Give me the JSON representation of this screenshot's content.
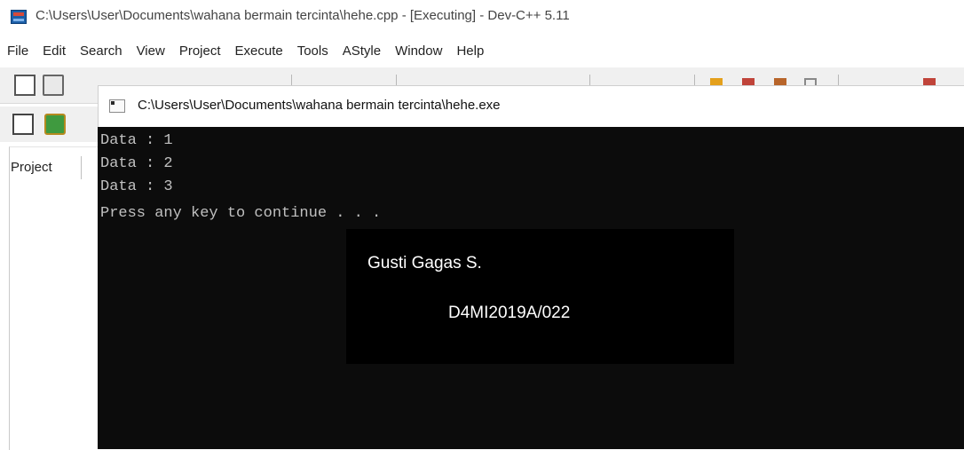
{
  "ide": {
    "title": "C:\\Users\\User\\Documents\\wahana bermain tercinta\\hehe.cpp - [Executing] - Dev-C++ 5.11",
    "menu": [
      "File",
      "Edit",
      "Search",
      "View",
      "Project",
      "Execute",
      "Tools",
      "AStyle",
      "Window",
      "Help"
    ],
    "left_panel_tab": "Project"
  },
  "console": {
    "title": "C:\\Users\\User\\Documents\\wahana bermain tercinta\\hehe.exe",
    "lines": [
      "Data : 1",
      "Data : 2",
      "Data : 3",
      "Press any key to continue . . ."
    ]
  },
  "overlay": {
    "name": "Gusti Gagas S.",
    "id": "D4MI2019A/022"
  },
  "colors": {
    "console_bg": "#0c0c0c",
    "console_text": "#c0c0c0",
    "overlay_bg": "#000000",
    "overlay_text": "#ffffff"
  }
}
